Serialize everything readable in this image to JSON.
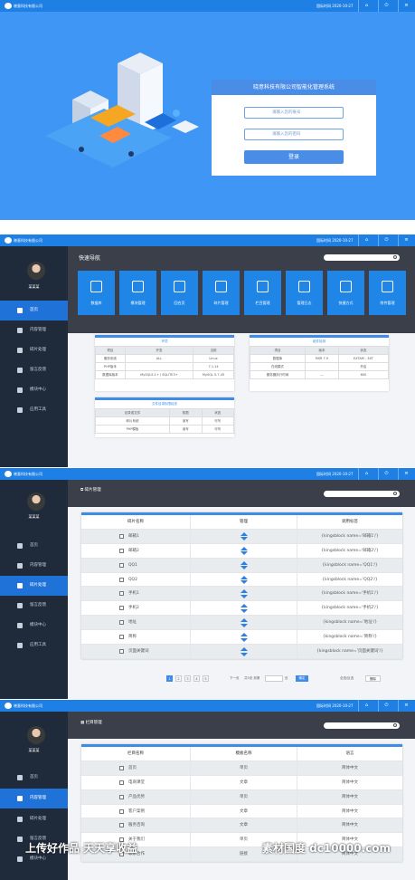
{
  "company": "晓意科技有限公司",
  "time": "国际时间 2020-10-27",
  "login": {
    "title": "晓意科技有限公司智能化管理系统",
    "account_placeholder": "请输入您的账号",
    "password_placeholder": "请输入您的密码",
    "submit": "登录"
  },
  "user": "某某某",
  "sidebar": [
    "首页",
    "内容管理",
    "碎片处理",
    "留言反馈",
    "模块中心",
    "应用工具"
  ],
  "home": {
    "title": "快速导航",
    "tiles": [
      "数据库",
      "模块管理",
      "回合页",
      "碎片管理",
      "栏目管理",
      "管理日志",
      "快捷方式",
      "附件管理"
    ],
    "card1": {
      "title": "环境",
      "head": [
        "项目",
        "开发",
        "当前"
      ],
      "rows": [
        [
          "服务系统",
          "ALL",
          "Linux"
        ],
        [
          "PHP版本",
          "",
          "7.1.14"
        ],
        [
          "数据库版本",
          "MySQL5.1+ / SQLITE3+",
          "MySQL 5.7.45"
        ]
      ]
    },
    "card2": {
      "title": "组件检测",
      "head": [
        "项目",
        "版本",
        "状态"
      ],
      "rows": [
        [
          "数据库",
          "MSR 7.9",
          "EXTAM - 3XT"
        ],
        [
          "在线模式",
          "",
          "开启"
        ],
        [
          "服务器执行时间",
          "---",
          "600"
        ]
      ]
    },
    "card3": {
      "title": "文件目录权限检查",
      "head": [
        "目录或文件",
        "权限",
        "状态"
      ],
      "rows": [
        [
          "碎片系统",
          "读写",
          "可写"
        ],
        [
          "PHP模板",
          "读写",
          "可写"
        ]
      ]
    }
  },
  "fragments": {
    "title": "碎片管理",
    "head": [
      "碎片名称",
      "管理",
      "调用标签"
    ],
    "rows": [
      [
        "邮箱1",
        "{kingsblock name='邮箱1'/}"
      ],
      [
        "邮箱2",
        "{kingsblock name='邮箱2'/}"
      ],
      [
        "QQ1",
        "{kingsblock name='QQ1'/}"
      ],
      [
        "QQ2",
        "{kingsblock name='QQ2'/}"
      ],
      [
        "手机1",
        "{kingsblock name='手机1'/}"
      ],
      [
        "手机2",
        "{kingsblock name='手机2'/}"
      ],
      [
        "地址",
        "{kingsblock name='地址'/}"
      ],
      [
        "简称",
        "{kingsblock name='简称'/}"
      ],
      [
        "页面关键词",
        "{kingsblock name='页面关键词'/}"
      ]
    ],
    "pager": {
      "pages": [
        "1",
        "2",
        "3",
        "4",
        "5"
      ],
      "next": "下一页",
      "total_label": "共5页 到第",
      "page_unit": "页",
      "go": "确定",
      "select_all": "全选/反选",
      "delete": "删除"
    }
  },
  "columns": {
    "title": "栏目管理",
    "head": [
      "栏目名称",
      "模板名称",
      "语言"
    ],
    "rows": [
      [
        "首页",
        "单页",
        "简体中文"
      ],
      [
        "电商课堂",
        "文章",
        "简体中文"
      ],
      [
        "产品优势",
        "单页",
        "简体中文"
      ],
      [
        "客户案例",
        "文章",
        "简体中文"
      ],
      [
        "服务咨询",
        "文章",
        "简体中文"
      ],
      [
        "关于我们",
        "单页",
        "简体中文"
      ],
      [
        "联系合作",
        "链接",
        "简体中文"
      ]
    ]
  },
  "watermark": {
    "left": "上传好作品 天天享收益",
    "right": "素材国度 dc10000.com"
  }
}
